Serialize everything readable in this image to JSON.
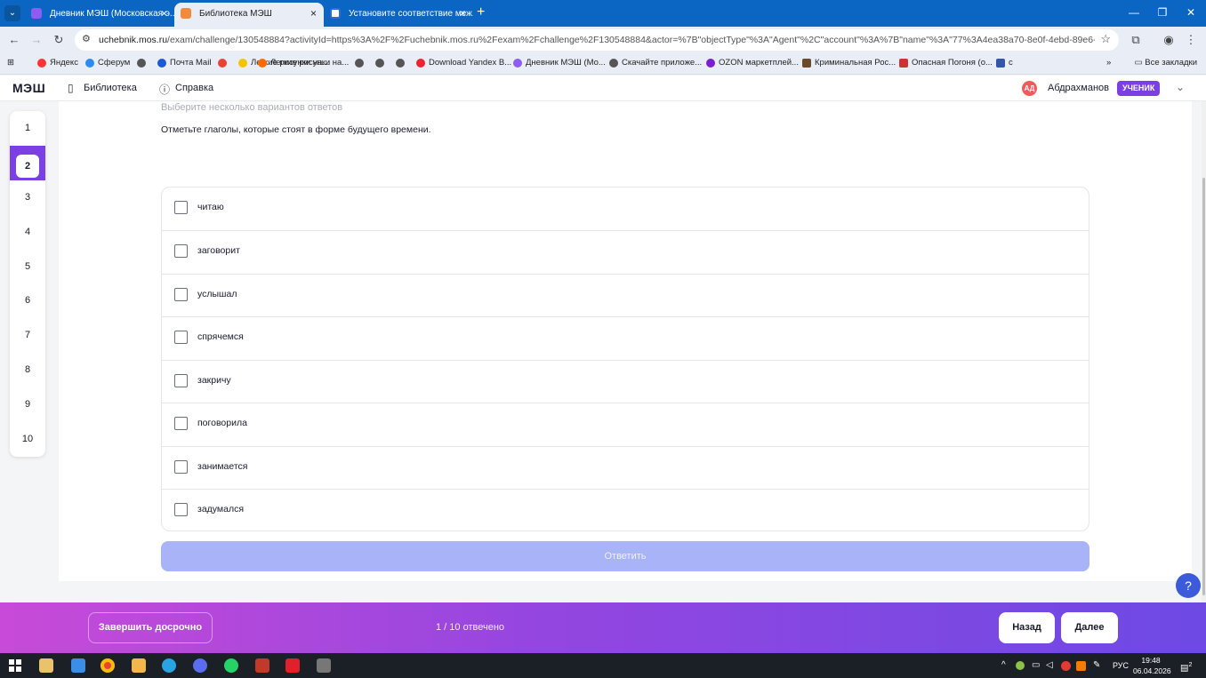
{
  "browser": {
    "tabs": [
      {
        "title": "Дневник МЭШ (Московская э...",
        "active": false
      },
      {
        "title": "Библиотека МЭШ",
        "active": true
      },
      {
        "title": "Установите соответствие меж...",
        "active": false
      }
    ],
    "url_host": "uchebnik.mos.ru",
    "url_rest": "/exam/challenge/130548884?activityId=https%3A%2F%2Fuchebnik.mos.ru%2Fexam%2Fchallenge%2F130548884&actor=%7B\"objectType\"%3A\"Agent\"%2C\"account\"%3A%7B\"name\"%3A\"77%3A4ea38a70-8e0f-4ebd-89e6-fde2675447b3\"...",
    "bookmarks": [
      "Яндекс",
      "Сферум",
      "Почта Mail",
      "",
      "",
      "Легкие рисунки на...",
      "",
      "",
      "",
      "Download Yandex B...",
      "Дневник МЭШ (Мо...",
      "Скачайте приложе...",
      "OZON маркетплей...",
      "Криминальная Рос...",
      "Опасная Погоня (о...",
      "с"
    ],
    "all_bookmarks": "Все закладки"
  },
  "header": {
    "logo": "МЭШ",
    "library": "Библиотека",
    "help": "Справка",
    "avatar_initials": "АД",
    "username": "Абдрахманов",
    "role": "УЧЕНИК"
  },
  "question_nav": {
    "items": [
      "1",
      "2",
      "3",
      "4",
      "5",
      "6",
      "7",
      "8",
      "9",
      "10"
    ],
    "active_index": 1
  },
  "question": {
    "hint": "Выберите несколько вариантов ответов",
    "text": "Отметьте глаголы, которые стоят в форме будущего времени.",
    "options": [
      "читаю",
      "заговорит",
      "услышал",
      "спрячемся",
      "закричу",
      "поговорила",
      "занимается",
      "задумался"
    ],
    "answer_label": "Ответить"
  },
  "footer": {
    "finish_label": "Завершить досрочно",
    "progress": "1 / 10 отвечено",
    "back_label": "Назад",
    "next_label": "Далее"
  },
  "help_button": "?",
  "taskbar": {
    "lang": "РУС",
    "time": "19:48",
    "date": "06.04.2026",
    "notifications": "2"
  },
  "colors": {
    "accent": "#7b3fe4",
    "answer_button": "#a8b4f7",
    "browser_chrome": "#0a66c2"
  }
}
